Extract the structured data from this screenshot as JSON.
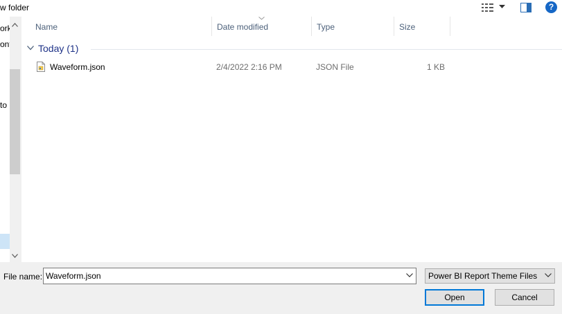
{
  "toolbar": {
    "new_folder_label": "w folder",
    "views_icon": "details-view-icon",
    "preview_icon": "preview-pane-icon",
    "help_label": "?"
  },
  "nav": {
    "items": [
      {
        "label": "ork"
      },
      {
        "label": "ont"
      },
      {
        "label": "to"
      }
    ]
  },
  "list": {
    "columns": [
      {
        "label": "Name"
      },
      {
        "label": "Date modified"
      },
      {
        "label": "Type"
      },
      {
        "label": "Size"
      }
    ],
    "group": {
      "label": "Today (1)"
    },
    "files": [
      {
        "name": "Waveform.json",
        "date": "2/4/2022 2:16 PM",
        "type": "JSON File",
        "size": "1 KB",
        "icon": "json-file-icon"
      }
    ]
  },
  "footer": {
    "file_name_label": "File name:",
    "file_name_value": "Waveform.json",
    "file_type_value": "Power BI Report Theme Files (*.",
    "open_label": "Open",
    "cancel_label": "Cancel"
  },
  "colors": {
    "accent": "#0078d7",
    "group_header": "#1e3287",
    "help_icon": "#1667c6"
  }
}
